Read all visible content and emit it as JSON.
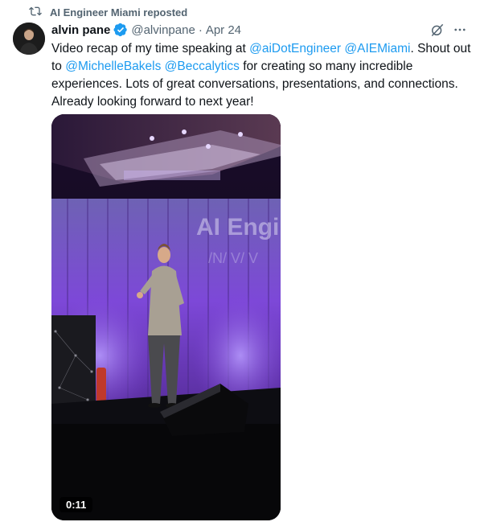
{
  "repost": {
    "label": "AI Engineer Miami reposted",
    "icon": "repost-icon"
  },
  "author": {
    "name": "alvin pane",
    "handle": "@alvinpane",
    "separator": "·",
    "date": "Apr 24",
    "verified": true,
    "verified_color": "#1d9bf0"
  },
  "tweet": {
    "parts": [
      {
        "text": "Video recap of my time speaking at ",
        "type": "text"
      },
      {
        "text": "@aiDotEngineer",
        "type": "mention"
      },
      {
        "text": " ",
        "type": "text"
      },
      {
        "text": "@AIEMiami",
        "type": "mention"
      },
      {
        "text": ". Shout out to ",
        "type": "text"
      },
      {
        "text": "@MichelleBakels",
        "type": "mention"
      },
      {
        "text": " ",
        "type": "text"
      },
      {
        "text": "@Beccalytics",
        "type": "mention"
      },
      {
        "text": " for creating so many incredible experiences. Lots of great conversations, presentations, and connections. Already looking forward to next year!",
        "type": "text"
      }
    ]
  },
  "video": {
    "duration": "0:11",
    "banner_text": "AI Engine"
  },
  "actions": {
    "grok_icon": "grok-icon",
    "more_icon": "more-icon"
  },
  "colors": {
    "accent": "#1d9bf0",
    "secondary_text": "#536471",
    "stage_purple": "#7a3fd6"
  }
}
